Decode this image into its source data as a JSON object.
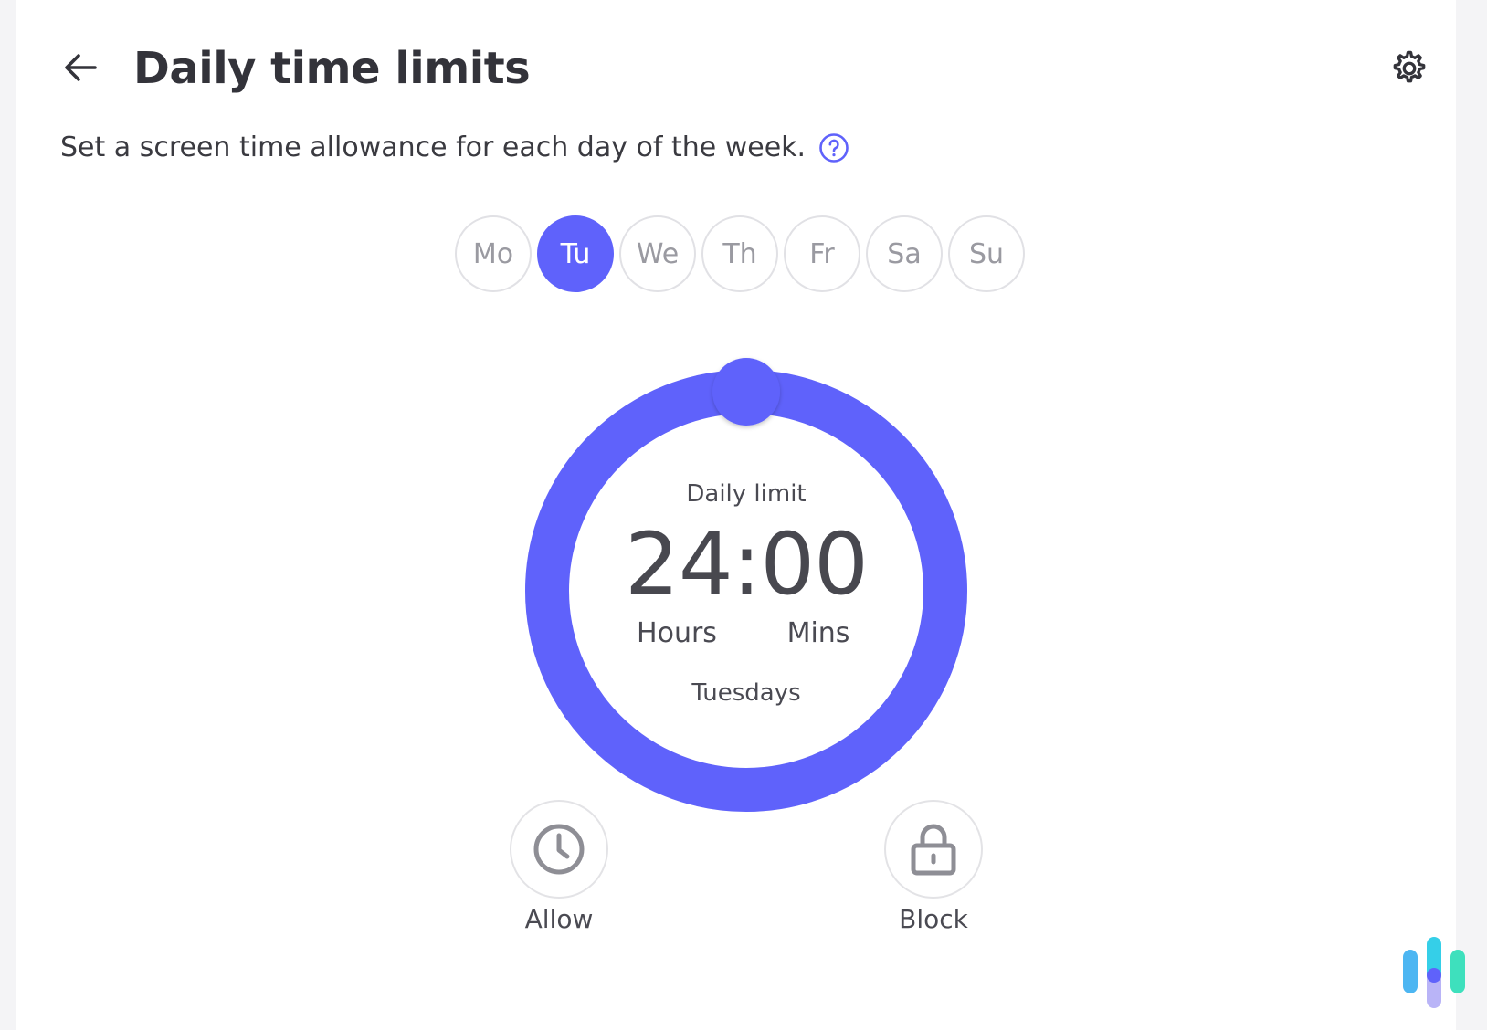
{
  "header": {
    "title": "Daily time limits",
    "back_icon": "arrow-left-icon",
    "settings_icon": "gear-icon"
  },
  "subtitle": {
    "text": "Set a screen time allowance for each day of the week.",
    "help_icon": "question-circle-icon"
  },
  "days": [
    {
      "label": "Mo",
      "selected": false
    },
    {
      "label": "Tu",
      "selected": true
    },
    {
      "label": "We",
      "selected": false
    },
    {
      "label": "Th",
      "selected": false
    },
    {
      "label": "Fr",
      "selected": false
    },
    {
      "label": "Sa",
      "selected": false
    },
    {
      "label": "Su",
      "selected": false
    }
  ],
  "dial": {
    "label": "Daily limit",
    "time": "24:00",
    "hours_label": "Hours",
    "mins_label": "Mins",
    "day_name": "Tuesdays",
    "fill_fraction": 1.0
  },
  "actions": {
    "allow": {
      "label": "Allow",
      "icon": "clock-icon"
    },
    "block": {
      "label": "Block",
      "icon": "lock-icon"
    }
  },
  "colors": {
    "accent": "#5f62fb",
    "text": "#3c3c43",
    "muted": "#9a9aa1",
    "border": "#e1e1e5"
  },
  "logo": {
    "icon": "brand-bars-icon"
  }
}
